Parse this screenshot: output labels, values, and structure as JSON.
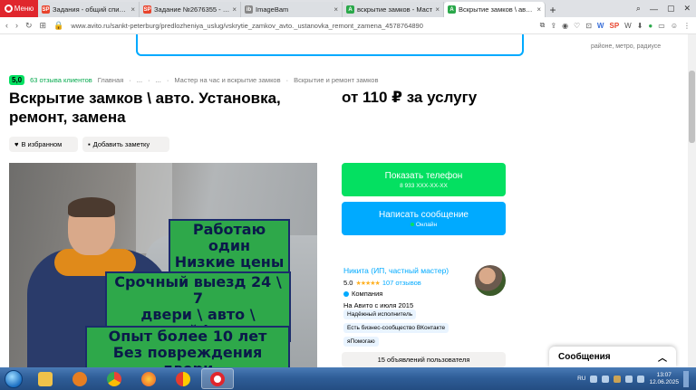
{
  "browser": {
    "menu_label": "Меню",
    "tabs": [
      {
        "title": "Задания - общий список",
        "favicon": "SP",
        "color": "#e8432c",
        "active": false
      },
      {
        "title": "Задание №2676355 - про",
        "favicon": "SP",
        "color": "#e8432c",
        "active": false
      },
      {
        "title": "ImageBam",
        "favicon": "ib",
        "color": "#888888",
        "active": false
      },
      {
        "title": "вскрытие замков - Маст",
        "favicon": "A",
        "color": "#2aa84a",
        "active": false
      },
      {
        "title": "Вскрытие замков \\ авто.",
        "favicon": "A",
        "color": "#2aa84a",
        "active": true
      }
    ],
    "url": "www.avito.ru/sankt-peterburg/predlozheniya_uslug/vskrytie_zamkov_avto._ustanovka_remont_zamena_4578764890"
  },
  "page": {
    "top_right_text": "районе, метро, радиусе",
    "rating": "5,0",
    "reviews_link": "63 отзыва клиентов",
    "breadcrumbs": [
      "Главная",
      "·",
      "...",
      "·",
      "...",
      "·",
      "Мастер на час и вскрытие замков",
      "·",
      "Вскрытие и ремонт замков"
    ],
    "title": "Вскрытие замков \\ авто. Установка, ремонт, замена",
    "price": "от 110 ₽ за услугу",
    "favorites_label": "В избранном",
    "note_label": "Добавить заметку",
    "photo_texts": [
      "Работаю один",
      "Низкие цены",
      "Срочный выезд 24 \\ 7",
      "двери \\ авто \\ сейфы",
      "Опыт более 10 лет",
      "Без повреждения двери"
    ],
    "phone_button": {
      "label": "Показать телефон",
      "sub": "8 933 XXX-XX-XX"
    },
    "message_button": {
      "label": "Написать сообщение",
      "sub": "Онлайн"
    },
    "seller": {
      "name": "Никита (ИП, частный мастер)",
      "rating": "5.0",
      "stars": "★★★★★",
      "reviews": "107 отзывов",
      "type": "Компания",
      "since": "На Авито с июля 2015"
    },
    "seller_tags": [
      "Надёжный исполнитель",
      "Есть бизнес-сообщество ВКонтакте",
      "яПомогаю"
    ],
    "listings_button": "15 объявлений пользователя",
    "messages_panel": "Сообщения"
  },
  "taskbar": {
    "lang": "RU",
    "time": "13:07",
    "date": "12.06.2025"
  }
}
